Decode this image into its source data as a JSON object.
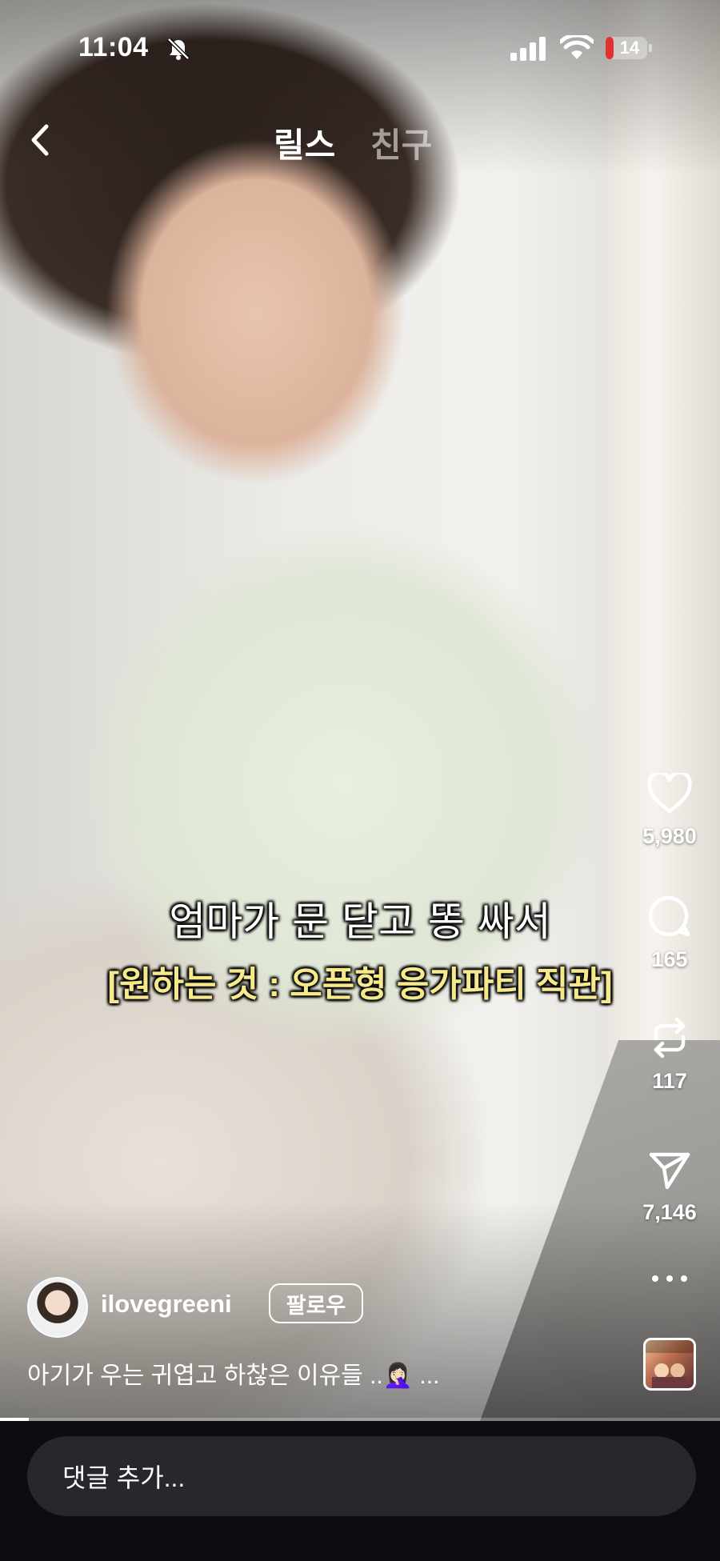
{
  "status_bar": {
    "time": "11:04",
    "battery": "14",
    "icons": [
      "bell-off-icon",
      "signal-icon",
      "wifi-icon",
      "battery-icon"
    ]
  },
  "header": {
    "back_icon": "chevron-left-icon",
    "tabs": [
      {
        "label": "릴스",
        "active": true
      },
      {
        "label": "친구",
        "active": false
      }
    ]
  },
  "video": {
    "subtitle_line1": "엄마가 문 닫고 똥 싸서",
    "subtitle_line2": "[원하는 것 : 오픈형 응가파티 직관]",
    "progress": 0.04
  },
  "actions": {
    "like": {
      "icon": "heart-icon",
      "count": "5,980"
    },
    "comment": {
      "icon": "comment-icon",
      "count": "165"
    },
    "repost": {
      "icon": "repost-icon",
      "count": "117"
    },
    "share": {
      "icon": "send-icon",
      "count": "7,146"
    },
    "more_icon": "more-icon",
    "audio_icon": "audio-thumbnail"
  },
  "author": {
    "username": "ilovegreeni",
    "follow_label": "팔로우",
    "caption": "아기가 우는 귀엽고 하찮은 이유들 ..🤦🏻‍♀️ ..."
  },
  "comment_bar": {
    "placeholder": "댓글 추가..."
  },
  "colors": {
    "subtitle_yellow": "#f6e98b",
    "bottom_bar": "#0c0d10",
    "input_bg": "#26282c"
  }
}
